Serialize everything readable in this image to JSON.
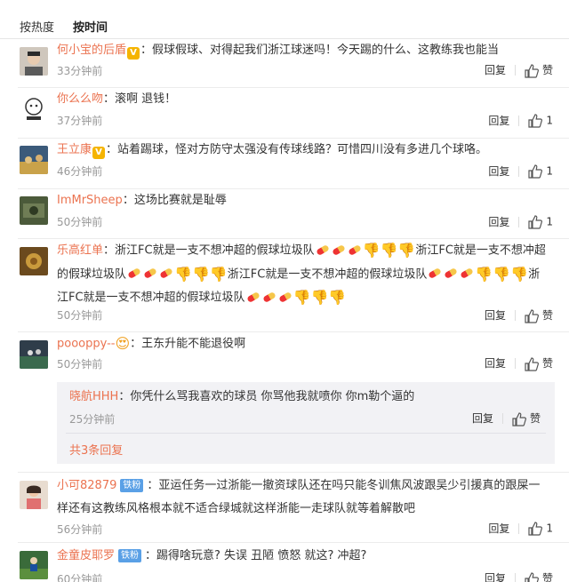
{
  "sort": {
    "by_hot": "按热度",
    "by_time": "按时间"
  },
  "actions": {
    "reply": "回复",
    "like": "赞"
  },
  "colors": {
    "username": "#eb7350",
    "time": "#999999",
    "vip_badge": "#f5b400",
    "fan_badge": "#5aa0e6",
    "reply_bg": "#f2f2f5"
  },
  "comments": [
    {
      "user": "何小宝的后盾",
      "badge": "V",
      "text": "：假球假球、对得起我们浙江球迷吗！今天踢的什么、这教练我也能当",
      "time": "33分钟前",
      "likes": ""
    },
    {
      "user": "你么么吻",
      "text": "：滚啊 退钱！",
      "time": "37分钟前",
      "likes": "1"
    },
    {
      "user": "王立康",
      "badge": "V",
      "text": "：站着踢球，怪对方防守太强没有传球线路？可惜四川没有多进几个球咯。",
      "time": "46分钟前",
      "likes": "1"
    },
    {
      "user": "ImMrSheep",
      "text": "：这场比赛就是耻辱",
      "time": "50分钟前",
      "likes": "1"
    },
    {
      "user": "乐高红单",
      "text_parts": [
        "：浙江FC就是一支不想冲超的假球垃圾队",
        "浙江FC就是一支不想冲超的假球垃圾队",
        "浙江FC就是一支不想冲超的假球垃圾队",
        "浙江FC就是一支不想冲超的假球垃圾队"
      ],
      "time": "50分钟前",
      "likes": ""
    },
    {
      "user": "pooоppy--",
      "text": "：王东升能不能退役啊",
      "time": "50分钟前",
      "likes": ""
    },
    {
      "user": "小可82879",
      "badge_fan": "铁粉",
      "text": "：亚运任务一过浙能一撤资球队还在吗只能冬训焦风波跟吴少引援真的跟屎一样还有这教练风格根本就不适合绿城就这样浙能一走球队就等着解散吧",
      "time": "56分钟前",
      "likes": "1"
    },
    {
      "user": "金童皮耶罗",
      "badge_fan": "铁粉",
      "text": "：踢得啥玩意? 失误 丑陋 愤怒 就这? 冲超?",
      "time": "60分钟前",
      "likes": ""
    }
  ],
  "reply": {
    "user": "晓航HHH",
    "text": "：你凭什么骂我喜欢的球员 你骂他我就喷你 你m勒个逼的",
    "time": "25分钟前",
    "likes": "",
    "more": "共3条回复"
  }
}
